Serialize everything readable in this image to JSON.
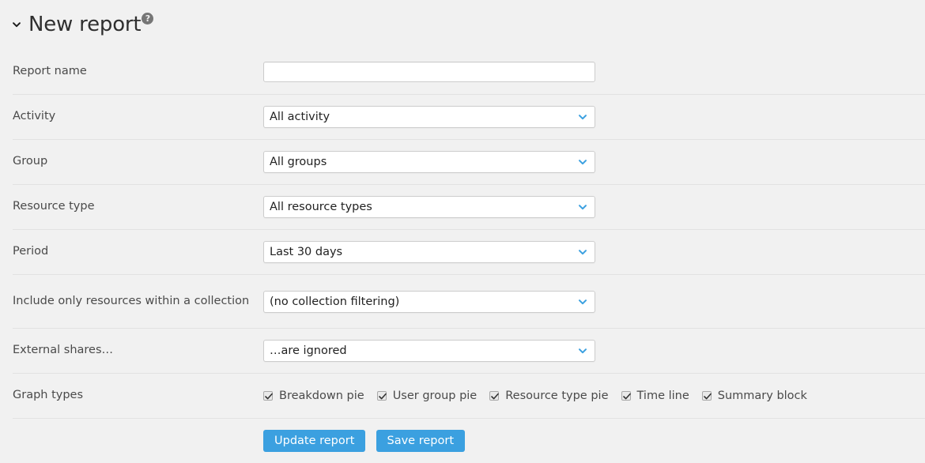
{
  "header": {
    "collapse_icon": "chevron-down-icon",
    "title": "New report",
    "help_icon_label": "?"
  },
  "colors": {
    "page_background": "#f1f1f1",
    "button_blue": "#3ba0e0",
    "chevron_blue": "#3ba0e0",
    "divider": "#e2e2e2",
    "label_text": "#4a4a4a"
  },
  "form": {
    "report_name": {
      "label": "Report name",
      "value": "",
      "placeholder": ""
    },
    "activity": {
      "label": "Activity",
      "value": "All activity"
    },
    "group": {
      "label": "Group",
      "value": "All groups"
    },
    "resource_type": {
      "label": "Resource type",
      "value": "All resource types"
    },
    "period": {
      "label": "Period",
      "value": "Last 30 days"
    },
    "collection": {
      "label": "Include only resources within a collection",
      "value": "(no collection filtering)"
    },
    "external_shares": {
      "label": "External shares…",
      "value": "…are ignored"
    },
    "graph_types": {
      "label": "Graph types",
      "options": [
        {
          "label": "Breakdown pie",
          "checked": true
        },
        {
          "label": "User group pie",
          "checked": true
        },
        {
          "label": "Resource type pie",
          "checked": true
        },
        {
          "label": "Time line",
          "checked": true
        },
        {
          "label": "Summary block",
          "checked": true
        }
      ]
    }
  },
  "actions": {
    "update_label": "Update report",
    "save_label": "Save report"
  }
}
